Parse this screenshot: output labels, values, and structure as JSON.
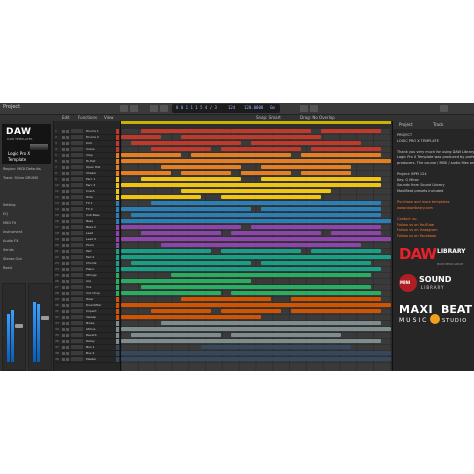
{
  "window": {
    "title": "Project"
  },
  "lcd": {
    "position": "0 0 1 1 1 5 4 / 3",
    "bpm": "124",
    "tempo": "120.0000",
    "key": "Gm"
  },
  "subbar": {
    "edit": "Edit",
    "functions": "Functions",
    "view": "View",
    "snap": "Snap: Smart",
    "drag": "Drag: No Overlap"
  },
  "inspector": {
    "cover": {
      "brand": "DAW",
      "tagline": "DAW TEMPLATES",
      "line1": "Logic Pro X",
      "line2": "Template"
    },
    "rows": [
      "Region: MIDI Defaults",
      "Track: Shine DRUMS",
      "",
      "",
      "Setting",
      "EQ",
      "MIDI FX",
      "Instrument",
      "Audio FX",
      "Sends",
      "Stereo Out",
      "Read"
    ]
  },
  "tracks": [
    {
      "name": "Drums 1",
      "color": "#c0392b"
    },
    {
      "name": "Drums 2",
      "color": "#c0392b"
    },
    {
      "name": "Kick",
      "color": "#c0392b"
    },
    {
      "name": "Snare",
      "color": "#c0392b"
    },
    {
      "name": "Clap",
      "color": "#e67e22"
    },
    {
      "name": "Hi-Hat",
      "color": "#e67e22"
    },
    {
      "name": "Open Hat",
      "color": "#e67e22"
    },
    {
      "name": "Shaker",
      "color": "#e67e22"
    },
    {
      "name": "Perc 1",
      "color": "#f1c40f"
    },
    {
      "name": "Perc 2",
      "color": "#f1c40f"
    },
    {
      "name": "Crash",
      "color": "#f1c40f"
    },
    {
      "name": "Ride",
      "color": "#f1c40f"
    },
    {
      "name": "FX 1",
      "color": "#2980b9"
    },
    {
      "name": "FX 2",
      "color": "#2980b9"
    },
    {
      "name": "Sub Bass",
      "color": "#2980b9"
    },
    {
      "name": "Bass",
      "color": "#2980b9"
    },
    {
      "name": "Bass 2",
      "color": "#8e44ad"
    },
    {
      "name": "Lead",
      "color": "#8e44ad"
    },
    {
      "name": "Lead 2",
      "color": "#8e44ad"
    },
    {
      "name": "Pluck",
      "color": "#8e44ad"
    },
    {
      "name": "Pad",
      "color": "#16a085"
    },
    {
      "name": "Pad 2",
      "color": "#16a085"
    },
    {
      "name": "Chords",
      "color": "#16a085"
    },
    {
      "name": "Piano",
      "color": "#16a085"
    },
    {
      "name": "Strings",
      "color": "#27ae60"
    },
    {
      "name": "Arp",
      "color": "#27ae60"
    },
    {
      "name": "Vox",
      "color": "#27ae60"
    },
    {
      "name": "Vox Chop",
      "color": "#27ae60"
    },
    {
      "name": "Riser",
      "color": "#d35400"
    },
    {
      "name": "Downlifter",
      "color": "#d35400"
    },
    {
      "name": "Impact",
      "color": "#d35400"
    },
    {
      "name": "Sweep",
      "color": "#d35400"
    },
    {
      "name": "Noise",
      "color": "#7f8c8d"
    },
    {
      "name": "Atmos",
      "color": "#7f8c8d"
    },
    {
      "name": "Reverb",
      "color": "#7f8c8d"
    },
    {
      "name": "Delay",
      "color": "#7f8c8d"
    },
    {
      "name": "Bus 1",
      "color": "#34495e"
    },
    {
      "name": "Bus 2",
      "color": "#34495e"
    },
    {
      "name": "Master",
      "color": "#34495e"
    }
  ],
  "notes": {
    "tabs": [
      "Project",
      "Track"
    ],
    "lines": [
      "PROJECT",
      "LOGIC PRO X TEMPLATE",
      "",
      "Thank you very much for using DAW Library Templates.",
      "Logic Pro X Template was produced by professional",
      "producers. The course / MIDI / audio files are",
      "",
      "Project: BPM 124",
      "Key: G Minor",
      "Sounds from Sound Library",
      "MaxiBeat presets included",
      "",
      "Purchase and more templates",
      "www.dawlibrary.com",
      "",
      "Contact us:",
      "Follow us on YouTube",
      "Follow us on Instagram",
      "Follow us on Facebook"
    ]
  },
  "logos": {
    "daw": {
      "big": "DAW",
      "s1": "LIBRARY",
      "s2": "",
      "s3": "MULTI-MEDIA GROUP"
    },
    "sound": {
      "mini": "MINI",
      "snd": "SOUND",
      "lib": "LIBRARY"
    },
    "maxi": {
      "m1": "MAXI",
      "m2": "BEAT",
      "m3": "MUSIC",
      "m4": "STUDIO"
    }
  }
}
